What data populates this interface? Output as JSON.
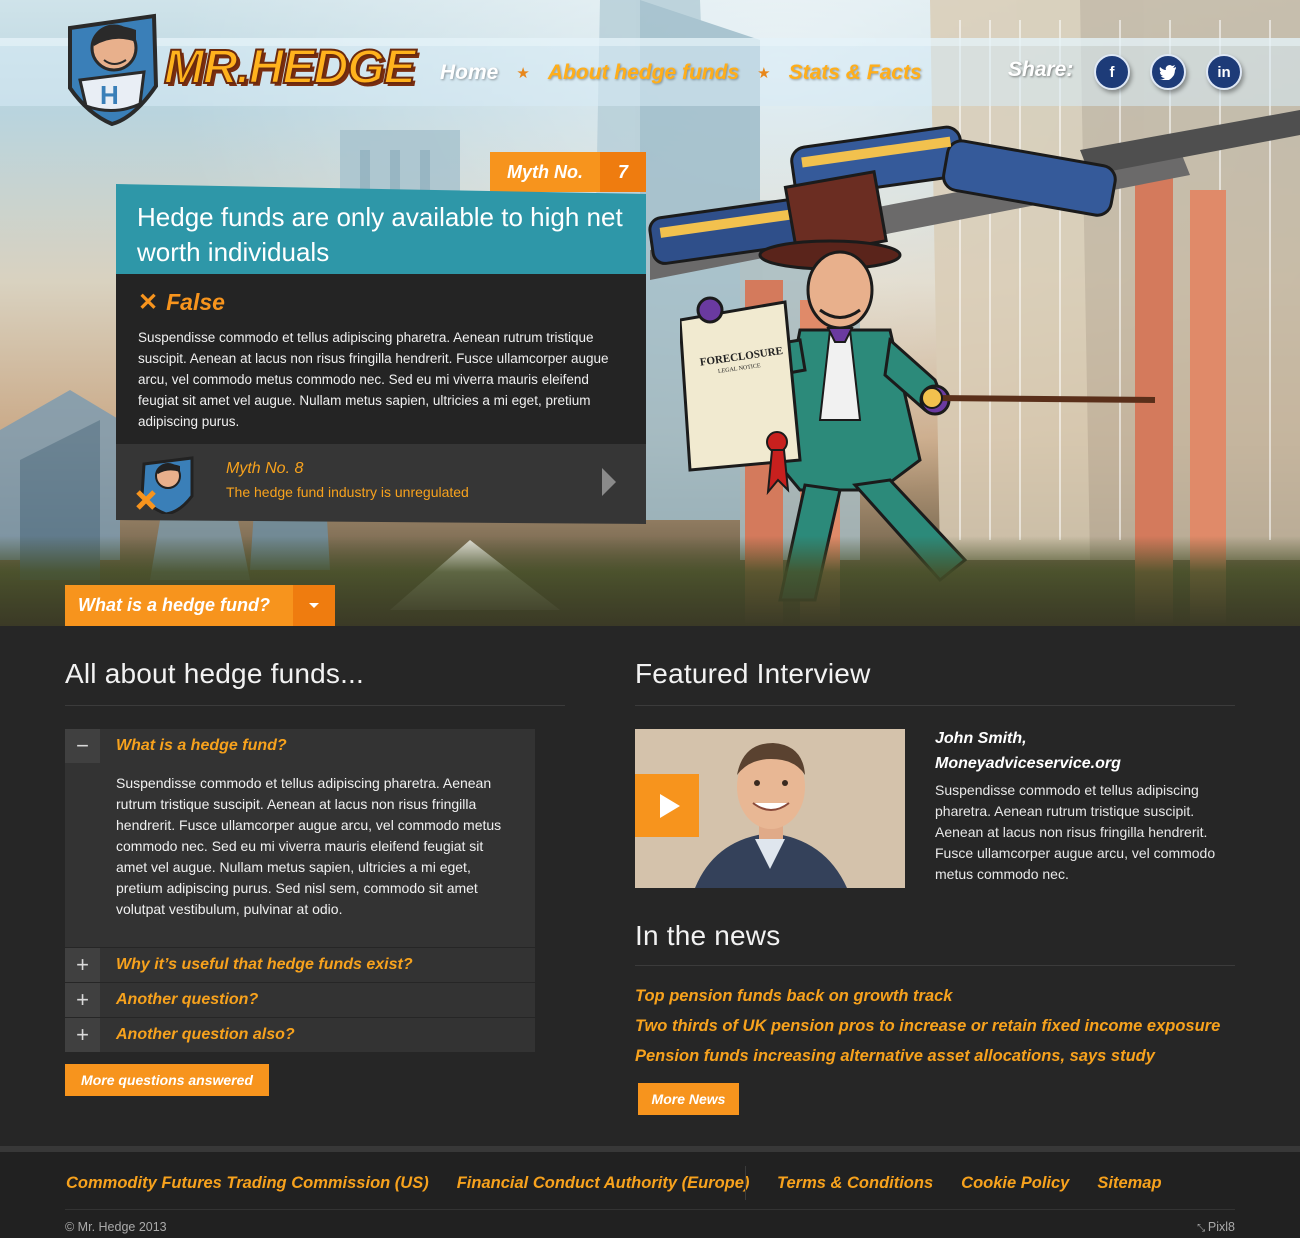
{
  "brand": {
    "name": "MR.HEDGE"
  },
  "nav": {
    "items": [
      "Home",
      "About hedge funds",
      "Stats & Facts"
    ],
    "share_label": "Share:",
    "social": [
      "f",
      "t",
      "in"
    ]
  },
  "myth": {
    "tag_label": "Myth No.",
    "tag_number": "7",
    "headline": "Hedge funds are only available to high net worth individuals",
    "verdict_icon": "✕",
    "verdict": "False",
    "body": "Suspendisse commodo et tellus adipiscing pharetra. Aenean rutrum tristique suscipit. Aenean at lacus non risus fringilla hendrerit. Fusce ullamcorper augue arcu, vel commodo metus commodo nec. Sed eu mi viverra mauris eleifend feugiat sit amet vel augue. Nullam metus sapien, ultricies a mi eget, pretium adipiscing purus.",
    "next_label": "Myth No. 8",
    "next_text": "The hedge fund industry is unregulated"
  },
  "hero_dropdown": {
    "label": "What is a hedge fund?"
  },
  "illustration": {
    "document_title": "FORECLOSURE",
    "document_subtitle": "LEGAL NOTICE"
  },
  "about": {
    "title": "All about hedge funds...",
    "accordion": [
      {
        "toggle": "−",
        "title": "What is a hedge fund?",
        "body": "Suspendisse commodo et tellus adipiscing pharetra. Aenean rutrum tristique suscipit. Aenean at lacus non risus fringilla hendrerit. Fusce ullamcorper augue arcu, vel commodo metus commodo nec. Sed eu mi viverra mauris eleifend feugiat sit amet vel augue. Nullam metus sapien, ultricies a mi eget, pretium adipiscing purus. Sed nisl sem, commodo sit amet volutpat vestibulum, pulvinar at odio."
      },
      {
        "toggle": "+",
        "title": "Why it’s useful that hedge funds exist?"
      },
      {
        "toggle": "+",
        "title": "Another question?"
      },
      {
        "toggle": "+",
        "title": "Another question also?"
      }
    ],
    "more_button": "More questions answered"
  },
  "interview": {
    "title": "Featured Interview",
    "name": "John Smith,",
    "org": "Moneyadviceservice.org",
    "body": "Suspendisse commodo et tellus adipiscing pharetra. Aenean rutrum tristique suscipit. Aenean at lacus non risus fringilla hendrerit. Fusce ullamcorper augue arcu, vel commodo metus commodo nec."
  },
  "news": {
    "title": "In the news",
    "items": [
      "Top pension funds back on growth track",
      "Two thirds of UK pension pros to increase or retain fixed income exposure",
      "Pension funds increasing alternative asset allocations, says study"
    ],
    "more_button": "More News"
  },
  "footer": {
    "left_links": [
      "Commodity Futures Trading Commission (US)",
      "Financial Conduct Authority (Europe)"
    ],
    "right_links": [
      "Terms & Conditions",
      "Cookie Policy",
      "Sitemap"
    ],
    "copyright": "© Mr. Hedge 2013",
    "credit": "Pixl8"
  },
  "colors": {
    "accent": "#f7941d",
    "teal": "#2e97a8",
    "dark": "#262626"
  }
}
